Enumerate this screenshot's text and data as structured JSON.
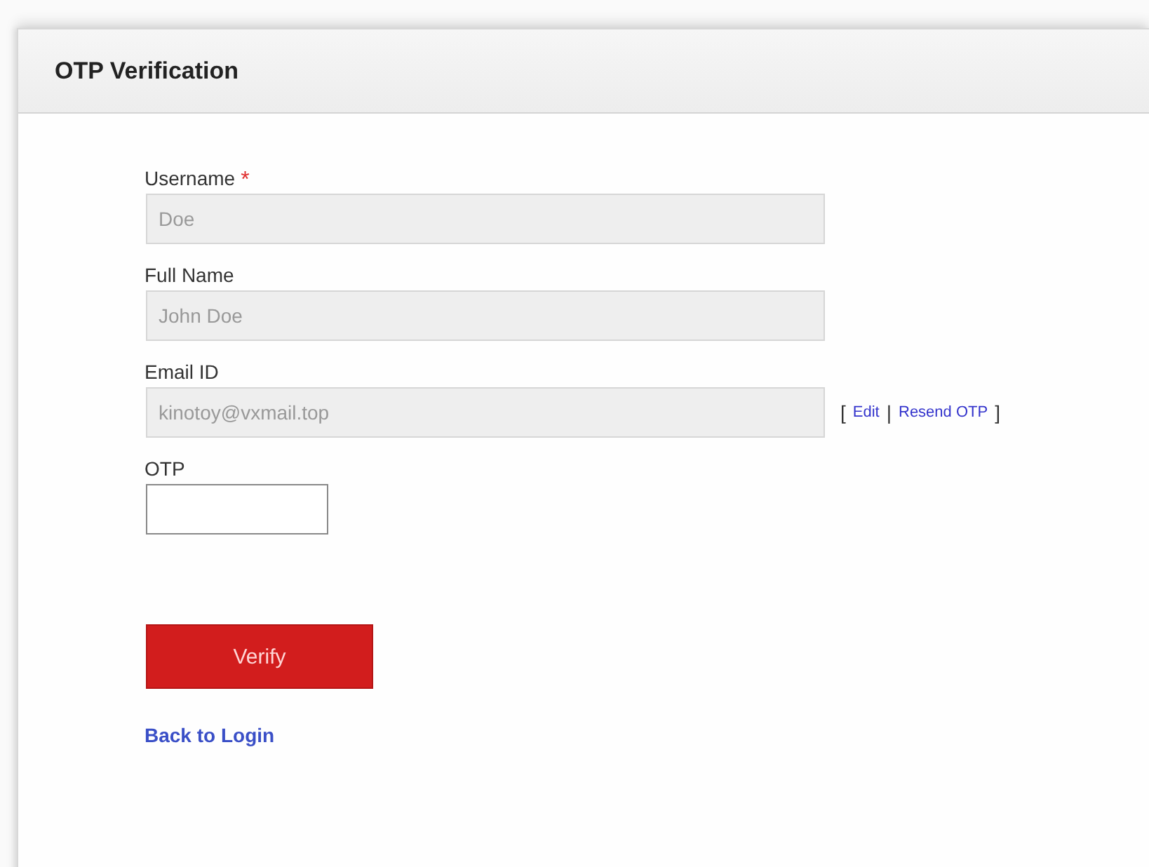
{
  "panel": {
    "title": "OTP Verification"
  },
  "fields": [
    {
      "label": "Username",
      "required": true,
      "value": "Doe",
      "disabled": true,
      "kind": "text"
    },
    {
      "label": "Full Name",
      "required": false,
      "value": "John Doe",
      "disabled": true,
      "kind": "text"
    },
    {
      "label": "Email ID",
      "required": false,
      "value": "kinotoy@vxmail.top",
      "disabled": true,
      "kind": "text",
      "links": [
        {
          "label": "Edit"
        },
        {
          "label": "Resend OTP"
        }
      ],
      "open_bracket": "[",
      "separator": "|",
      "close_bracket": "]"
    },
    {
      "label": "OTP",
      "required": false,
      "disabled": false,
      "kind": "code"
    }
  ],
  "required_mark": "*",
  "submit_button": "Verify",
  "back_link": "Back to Login"
}
